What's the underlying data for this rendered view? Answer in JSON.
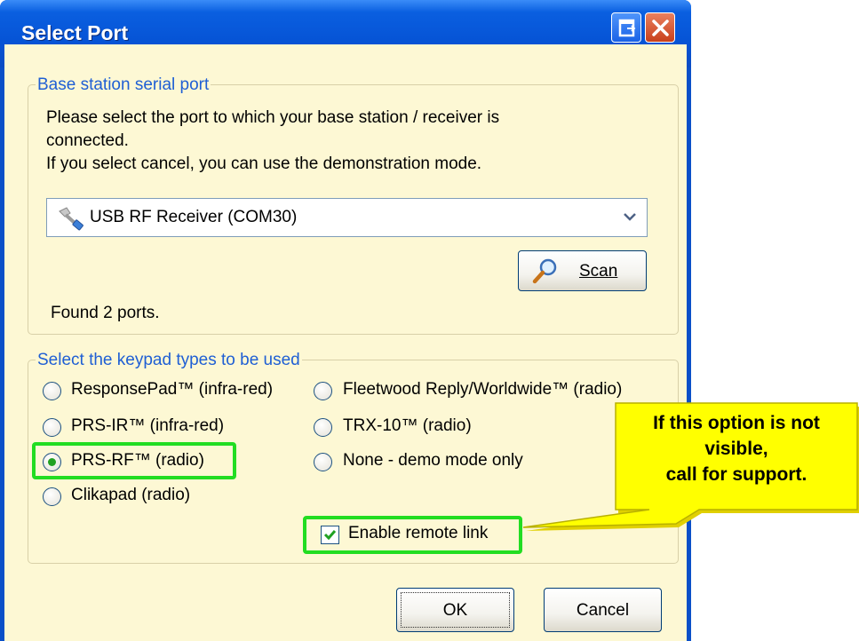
{
  "window": {
    "title": "Select Port",
    "restore_icon": "restore-window-icon",
    "close_icon": "close-icon"
  },
  "port_group": {
    "legend": "Base station serial port",
    "instructions": [
      "Please select the port to which your base station / receiver is",
      "connected.",
      "If you select cancel, you can use the demonstration mode."
    ],
    "selected_port": "USB RF Receiver (COM30)",
    "port_icon": "usb-plug-icon",
    "scan_label": "Scan",
    "scan_icon": "magnifier-icon",
    "status": "Found 2 ports."
  },
  "keypad_group": {
    "legend": "Select the keypad types to be used",
    "options": [
      {
        "label": "ResponsePad™ (infra-red)",
        "checked": false
      },
      {
        "label": "Fleetwood Reply/Worldwide™ (radio)",
        "checked": false
      },
      {
        "label": "PRS-IR™ (infra-red)",
        "checked": false
      },
      {
        "label": "TRX-10™ (radio)",
        "checked": false
      },
      {
        "label": "PRS-RF™ (radio)",
        "checked": true
      },
      {
        "label": "None - demo mode only",
        "checked": false
      },
      {
        "label": "Clikapad (radio)",
        "checked": false
      }
    ],
    "remote_link_label": "Enable remote link",
    "remote_link_checked": true
  },
  "buttons": {
    "ok": "OK",
    "cancel": "Cancel"
  },
  "callout": {
    "lines": [
      "If this option is not",
      "visible,",
      "call for support."
    ]
  },
  "colors": {
    "titlebar": "#0a5fe0",
    "dialog_bg": "#fdf8d4",
    "legend_text": "#1f5fd4",
    "highlight": "#22dd22",
    "callout_fill": "#ffff00"
  }
}
